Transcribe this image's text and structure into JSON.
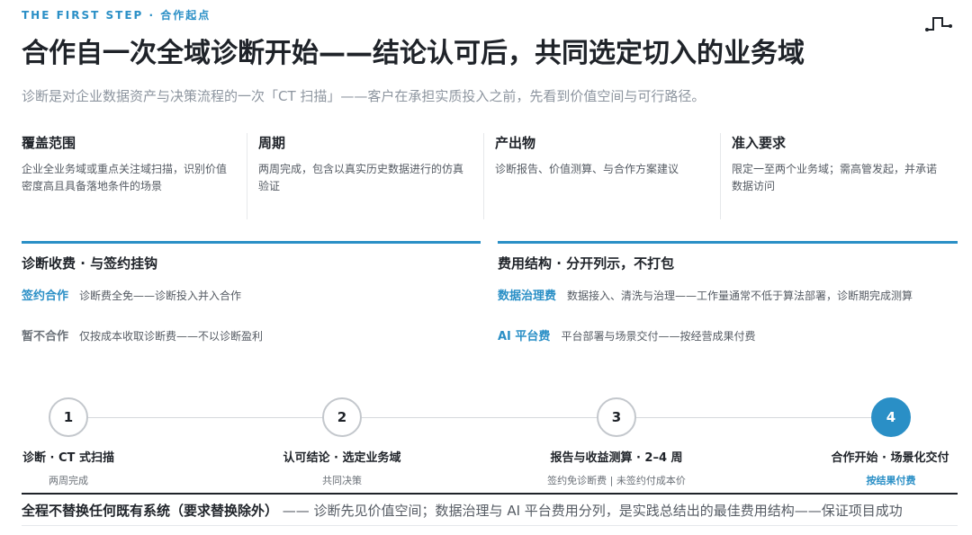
{
  "eyebrow": "THE FIRST STEP · 合作起点",
  "title": "合作自一次全域诊断开始——结论认可后，共同选定切入的业务域",
  "subtitle": "诊断是对企业数据资产与决策流程的一次「CT 扫描」——客户在承担实质投入之前，先看到价值空间与可行路径。",
  "columns": [
    {
      "heading": "覆盖范围",
      "body": "企业全业务域或重点关注域扫描，识别价值密度高且具备落地条件的场景"
    },
    {
      "heading": "周期",
      "body": "两周完成，包含以真实历史数据进行的仿真验证"
    },
    {
      "heading": "产出物",
      "body": "诊断报告、价值测算、与合作方案建议"
    },
    {
      "heading": "准入要求",
      "body": "限定一至两个业务域；需高管发起，并承诺数据访问"
    }
  ],
  "fees": {
    "heading": "诊断收费 · 与签约挂钩",
    "rows": [
      {
        "key": "签约合作",
        "text": "诊断费全免——诊断投入并入合作"
      },
      {
        "key": "暂不合作",
        "text": "仅按成本收取诊断费——不以诊断盈利"
      }
    ]
  },
  "structure": {
    "heading": "费用结构 · 分开列示，不打包",
    "rows": [
      {
        "key": "数据治理费",
        "text": "数据接入、清洗与治理——工作量通常不低于算法部署，诊断期完成测算"
      },
      {
        "key": "AI 平台费",
        "text": "平台部署与场景交付——按经营成果付费"
      }
    ]
  },
  "steps": [
    {
      "num": "1",
      "label": "诊断 · CT 式扫描",
      "sub": "两周完成"
    },
    {
      "num": "2",
      "label": "认可结论 · 选定业务域",
      "sub": "共同决策"
    },
    {
      "num": "3",
      "label": "报告与收益测算 · 2–4 周",
      "sub": "签约免诊断费 | 未签约付成本价"
    },
    {
      "num": "4",
      "label": "合作开始 · 场景化交付",
      "sub": "按结果付费"
    }
  ],
  "footer": {
    "bold": "全程不替换任何既有系统（要求替换除外）",
    "rest": " —— 诊断先见价值空间；数据治理与 AI 平台费用分列，是实践总结出的最佳费用结构——保证项目成功"
  },
  "colors": {
    "accent": "#2a8fc6",
    "text": "#1f2329",
    "muted": "#8d959f"
  }
}
